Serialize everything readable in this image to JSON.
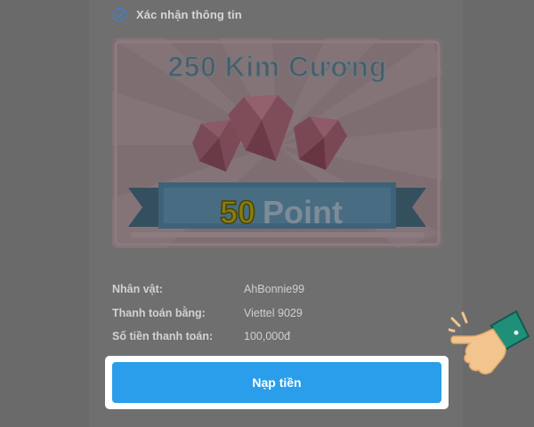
{
  "confirm": {
    "label": "Xác nhận thông tin"
  },
  "promo": {
    "title": "250 Kim Cương",
    "ribbon_number": "50",
    "ribbon_word": "Point"
  },
  "details": [
    {
      "label": "Nhân vật:",
      "value": "AhBonnie99"
    },
    {
      "label": "Thanh toán bằng:",
      "value": "Viettel 9029"
    },
    {
      "label": "Số tiền thanh toán:",
      "value": "100,000đ"
    }
  ],
  "topup_button": {
    "label": "Nạp tiền"
  },
  "colors": {
    "overlay_bg": "#676767",
    "button_blue": "#2a9eea",
    "check_blue": "#3f7fcf",
    "highlight": "#ffffff"
  },
  "icons": {
    "check": "check-circle-icon",
    "pointer": "hand-pointer-icon",
    "gem": "diamond-icon"
  }
}
